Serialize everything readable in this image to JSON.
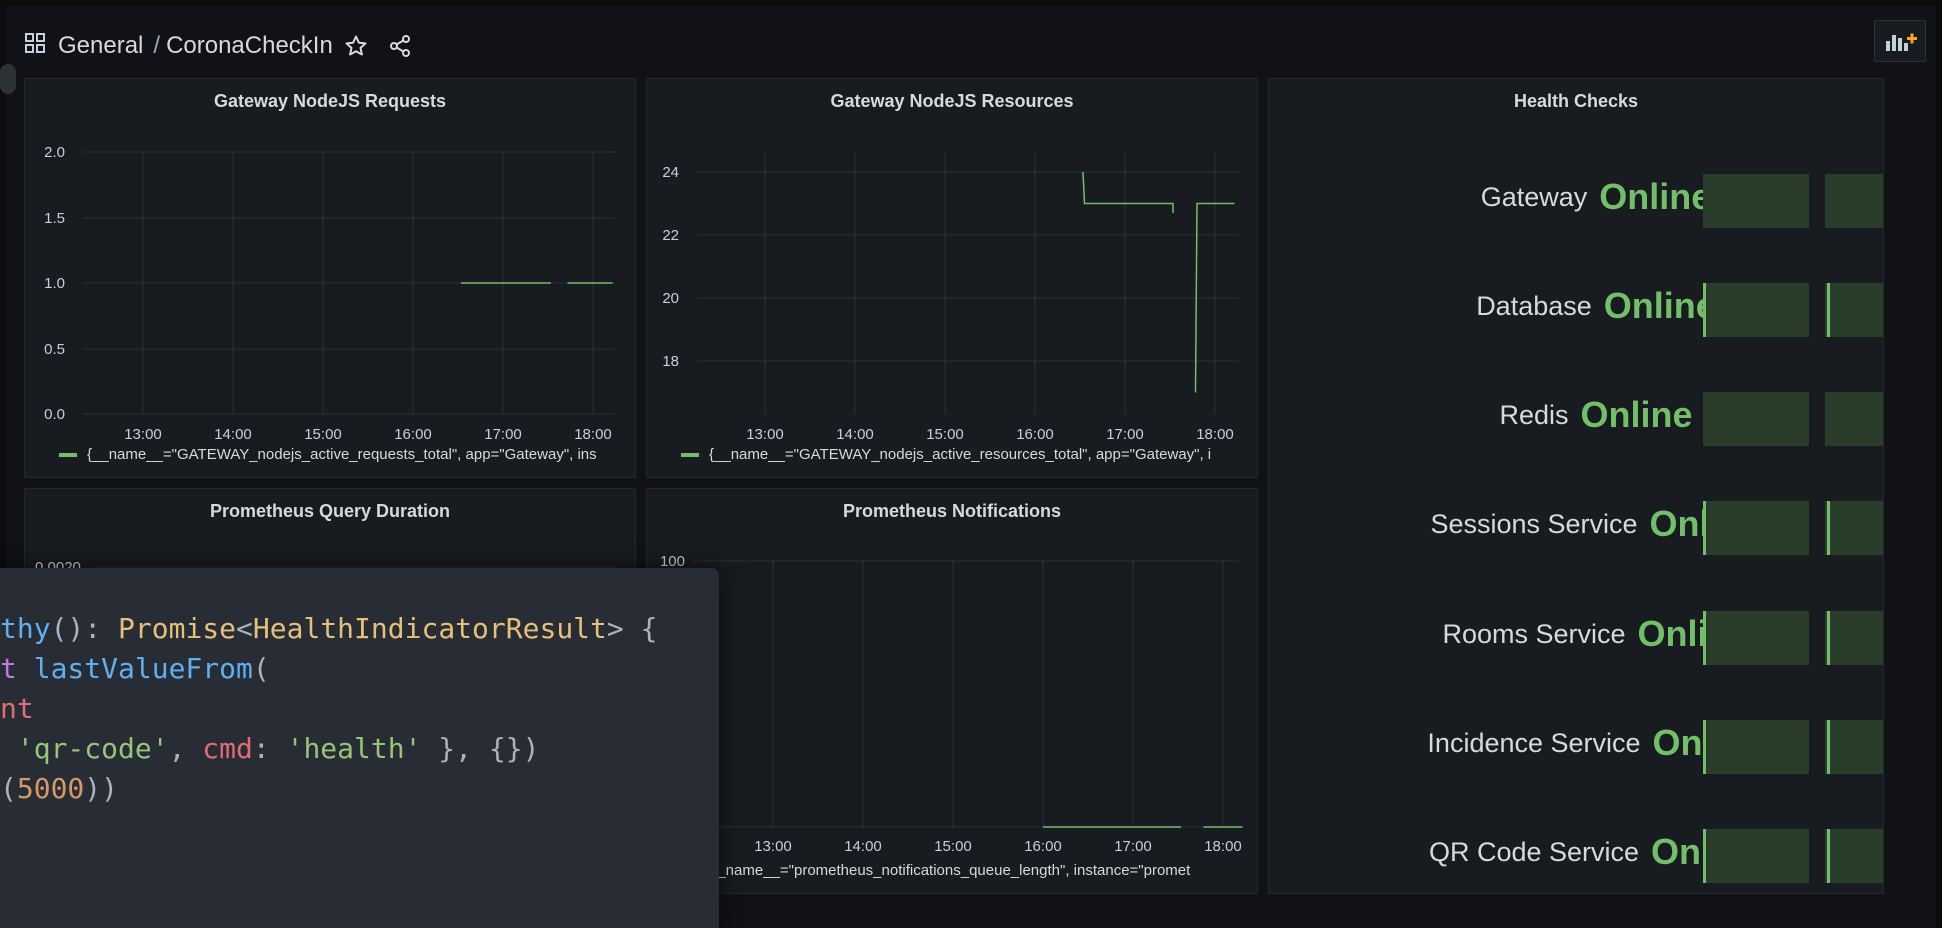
{
  "breadcrumb": {
    "folder": "General",
    "separator": "/",
    "dashboard": "CoronaCheckIn"
  },
  "icons": {
    "dashboards": "grid-icon",
    "star": "star-icon",
    "share": "share-icon",
    "add_panel": "add-panel-icon"
  },
  "colors": {
    "series": "#73bf69",
    "bg": "#111217",
    "panel": "#181b1f",
    "health_bar": "#2a3d2b"
  },
  "panels": {
    "requests": {
      "title": "Gateway NodeJS Requests",
      "legend": "{__name__=\"GATEWAY_nodejs_active_requests_total\", app=\"Gateway\", ins"
    },
    "resources": {
      "title": "Gateway NodeJS Resources",
      "legend": "{__name__=\"GATEWAY_nodejs_active_resources_total\", app=\"Gateway\", i"
    },
    "query_duration": {
      "title": "Prometheus Query Duration"
    },
    "notifications": {
      "title": "Prometheus Notifications",
      "legend": "__name__=\"prometheus_notifications_queue_length\", instance=\"promet"
    },
    "health": {
      "title": "Health Checks",
      "items": [
        {
          "label": "Gateway",
          "status": "Online"
        },
        {
          "label": "Database",
          "status": "Online"
        },
        {
          "label": "Redis",
          "status": "Online"
        },
        {
          "label": "Sessions Service",
          "status": "Online"
        },
        {
          "label": "Rooms Service",
          "status": "Online"
        },
        {
          "label": "Incidence Service",
          "status": "Online"
        },
        {
          "label": "QR Code Service",
          "status": "Online"
        }
      ]
    }
  },
  "chart_data": [
    {
      "type": "line",
      "title": "Gateway NodeJS Requests",
      "x_ticks": [
        "13:00",
        "14:00",
        "15:00",
        "16:00",
        "17:00",
        "18:00"
      ],
      "y_ticks": [
        "0.0",
        "0.5",
        "1.0",
        "1.5",
        "2.0"
      ],
      "ylim": [
        0,
        2.0
      ],
      "grid": true,
      "legend_position": "bottom",
      "series": [
        {
          "segments": [
            {
              "x": [
                "16:32",
                "17:32"
              ],
              "y": [
                1,
                1
              ]
            },
            {
              "x": [
                "17:43",
                "18:13"
              ],
              "y": [
                1,
                1
              ]
            }
          ]
        }
      ]
    },
    {
      "type": "line",
      "title": "Gateway NodeJS Resources",
      "x_ticks": [
        "13:00",
        "14:00",
        "15:00",
        "16:00",
        "17:00",
        "18:00"
      ],
      "y_ticks": [
        "18",
        "20",
        "22",
        "24"
      ],
      "ylim": [
        16.1,
        24.7
      ],
      "grid": true,
      "legend_position": "bottom",
      "series": [
        {
          "segments": [
            {
              "x": [
                "16:32",
                "16:33",
                "17:32",
                "17:32"
              ],
              "y": [
                24,
                23,
                23,
                22.7
              ]
            },
            {
              "x": [
                "17:47",
                "17:48",
                "18:13"
              ],
              "y": [
                17,
                23,
                23
              ]
            }
          ]
        }
      ]
    },
    {
      "type": "line",
      "title": "Prometheus Query Duration",
      "y_ticks": [
        "0.0020"
      ],
      "grid": true
    },
    {
      "type": "line",
      "title": "Prometheus Notifications",
      "x_ticks": [
        "13:00",
        "14:00",
        "15:00",
        "16:00",
        "17:00",
        "18:00"
      ],
      "y_ticks": [
        "100"
      ],
      "ylim": [
        0,
        100
      ],
      "grid": true,
      "legend_position": "bottom",
      "series": [
        {
          "segments": [
            {
              "x": [
                "16:00",
                "17:32"
              ],
              "y": [
                0,
                0
              ]
            },
            {
              "x": [
                "17:47",
                "18:13"
              ],
              "y": [
                0,
                0
              ]
            }
          ]
        }
      ]
    }
  ],
  "code_overlay": {
    "lines": [
      [
        {
          "t": "thy",
          "c": "fn"
        },
        {
          "t": "(): ",
          "c": "p"
        },
        {
          "t": "Promise",
          "c": "ty"
        },
        {
          "t": "<",
          "c": "p"
        },
        {
          "t": "HealthIndicatorResult",
          "c": "ty"
        },
        {
          "t": "> {",
          "c": "p"
        }
      ],
      [
        {
          "t": "t ",
          "c": "kw"
        },
        {
          "t": "lastValueFrom",
          "c": "fn"
        },
        {
          "t": "(",
          "c": "p"
        }
      ],
      [
        {
          "t": "nt",
          "c": "var"
        }
      ],
      [
        {
          "t": " ",
          "c": "p"
        },
        {
          "t": "'qr-code'",
          "c": "str"
        },
        {
          "t": ", ",
          "c": "p"
        },
        {
          "t": "cmd",
          "c": "var"
        },
        {
          "t": ": ",
          "c": "p"
        },
        {
          "t": "'health'",
          "c": "str"
        },
        {
          "t": " }, {})",
          "c": "p"
        }
      ],
      [
        {
          "t": "(",
          "c": "p"
        },
        {
          "t": "5000",
          "c": "num"
        },
        {
          "t": "))",
          "c": "p"
        }
      ]
    ]
  }
}
